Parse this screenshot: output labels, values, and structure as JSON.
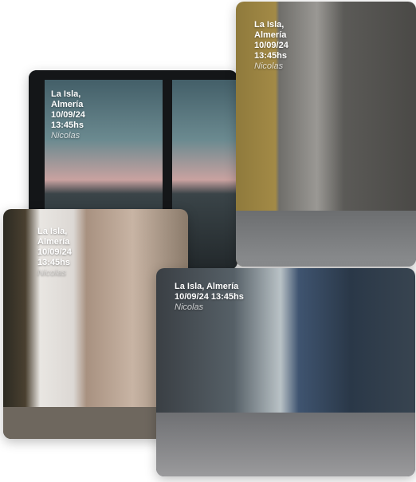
{
  "cards": [
    {
      "place": "La Isla,",
      "region": "Almería",
      "date": "10/09/24",
      "time": "13:45hs",
      "author": "Nicolas"
    },
    {
      "place": "La Isla,",
      "region": "Almería",
      "date": "10/09/24",
      "time": "13:45hs",
      "author": "Nicolas"
    },
    {
      "place": "La Isla,",
      "region": "Almería",
      "date": "10/09/24",
      "time": "13:45hs",
      "author": "Nicolas"
    },
    {
      "place": "La Isla, Almería",
      "date": "10/09/24",
      "time": "13:45hs",
      "author": "Nicolas"
    }
  ]
}
